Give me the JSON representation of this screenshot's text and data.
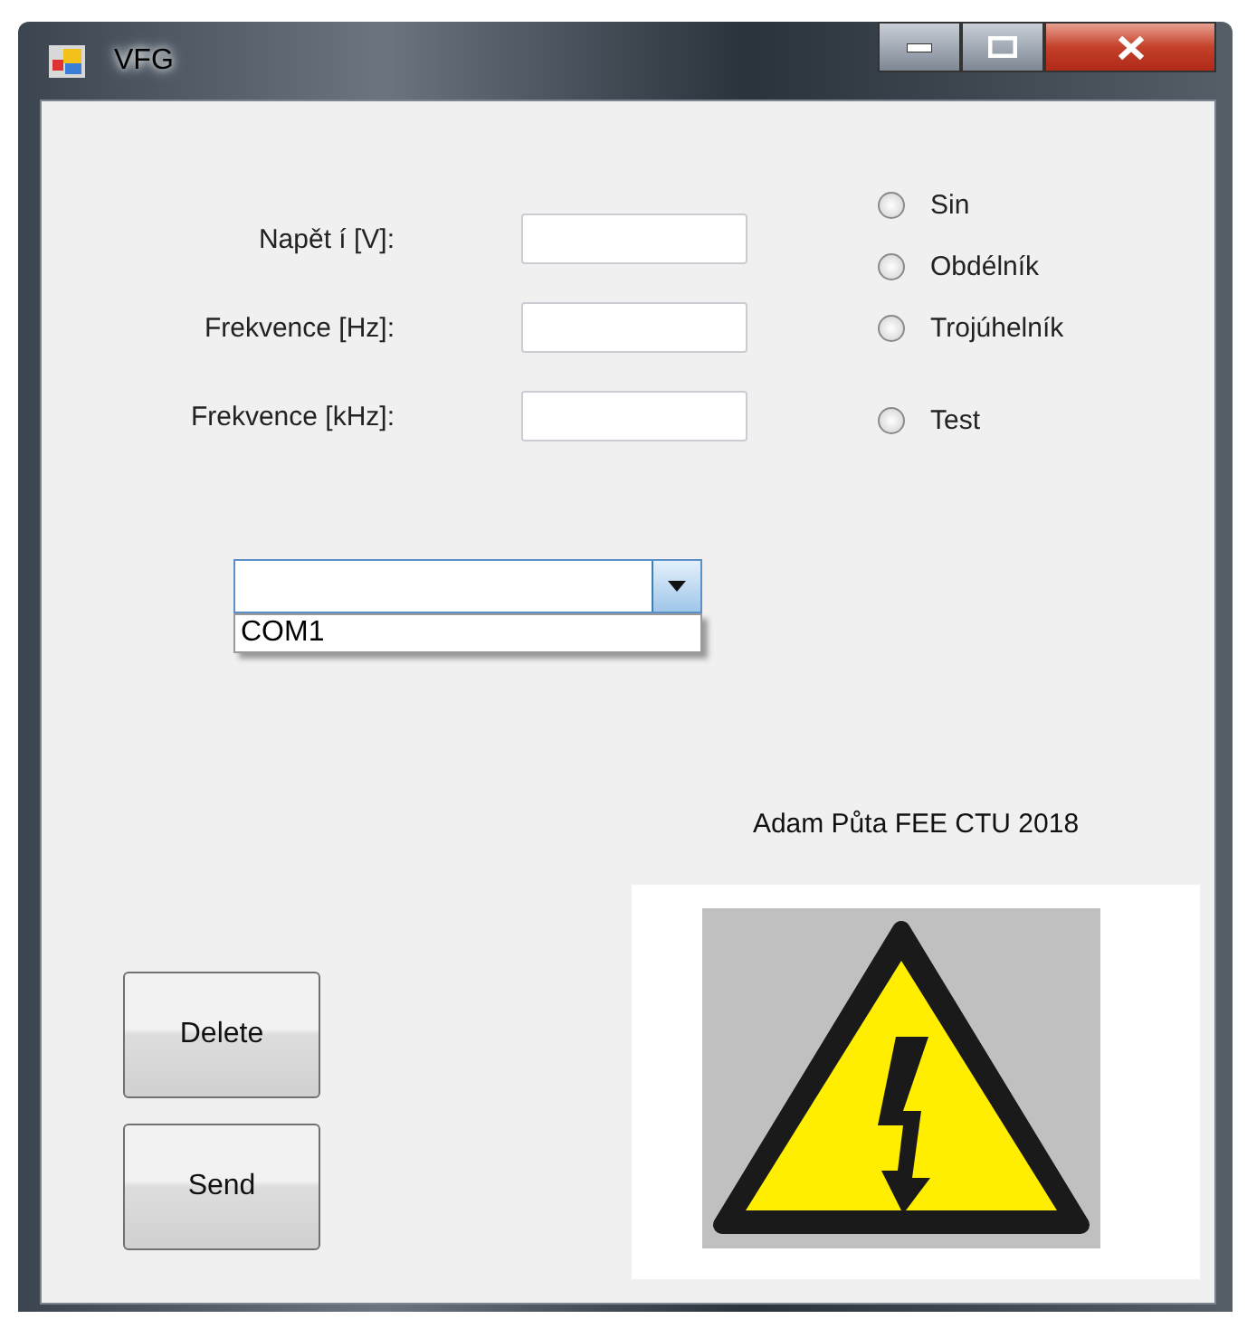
{
  "window": {
    "title": "VFG"
  },
  "fields": [
    {
      "label": "Napět í [V]:"
    },
    {
      "label": "Frekvence [Hz]:"
    },
    {
      "label": "Frekvence [kHz]:"
    }
  ],
  "waveforms": [
    {
      "label": "Sin",
      "selected": false
    },
    {
      "label": "Obdélník",
      "selected": false
    },
    {
      "label": "Trojúhelník",
      "selected": false
    },
    {
      "label": "Test",
      "selected": false
    }
  ],
  "port_combo": {
    "expanded": true,
    "options": [
      "COM1"
    ]
  },
  "buttons": [
    "Delete",
    "Send"
  ],
  "caption": "Adam Půta FEE CTU 2018",
  "image": {
    "kind": "picture"
  }
}
